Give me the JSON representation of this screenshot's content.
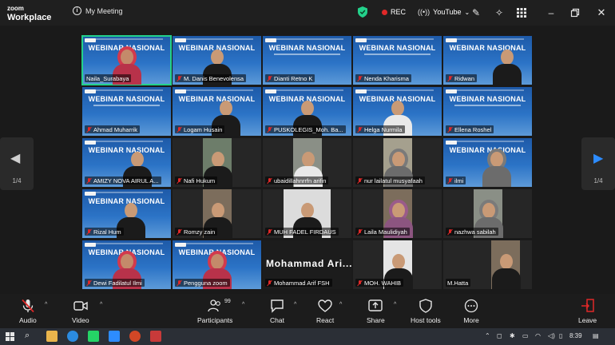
{
  "app": {
    "brand_line1": "zoom",
    "brand_line2": "Workplace",
    "meeting_label": "My Meeting",
    "rec_label": "REC",
    "stream_label": "YouTube"
  },
  "webinar_banner": "WEBINAR NASIONAL",
  "tiles": [
    {
      "name": "Naila_Surabaya"
    },
    {
      "name": "M. Danis Benevolensa"
    },
    {
      "name": "Dianti Retno K"
    },
    {
      "name": "Nenda Kharisma"
    },
    {
      "name": "Ridwan"
    },
    {
      "name": "Ahmad Muharrik"
    },
    {
      "name": "Logam Husain"
    },
    {
      "name": "PUSKOLEGIS_Moh. Ba..."
    },
    {
      "name": "Helga Nurmila"
    },
    {
      "name": "Ellena Roshel"
    },
    {
      "name": "AMIZY NOVA AIRUL A..."
    },
    {
      "name": "Nafi Hukum"
    },
    {
      "name": "ubaidillahnrrfn arifin"
    },
    {
      "name": "nur lailatul musyafaah"
    },
    {
      "name": "ilmi"
    },
    {
      "name": "Rizal Hum"
    },
    {
      "name": "Romzy zain"
    },
    {
      "name": "MUH FADEL FIRDAUS"
    },
    {
      "name": "Laila Maulidiyah"
    },
    {
      "name": "nazhwa sabilah"
    },
    {
      "name": "Dewi Fadilatul Ilmi"
    },
    {
      "name": "Pengguna zoom"
    },
    {
      "name": "Mohammad Arif FSH",
      "display_text": "Mohammad  Ari..."
    },
    {
      "name": "MOH. WAHIB"
    },
    {
      "name": "M.Hatta"
    }
  ],
  "pager": {
    "left_page": "1/4",
    "right_page": "1/4"
  },
  "toolbar": {
    "audio": "Audio",
    "video": "Video",
    "participants": "Participants",
    "participants_count": "99",
    "chat": "Chat",
    "react": "React",
    "share": "Share",
    "host_tools": "Host tools",
    "more": "More",
    "leave": "Leave"
  },
  "taskbar": {
    "clock": "8:39"
  },
  "colors": {
    "accent_green": "#23d18b",
    "rec_red": "#e02828",
    "arrow_blue": "#2d8cff",
    "banner_blue": "#2b73c6"
  }
}
